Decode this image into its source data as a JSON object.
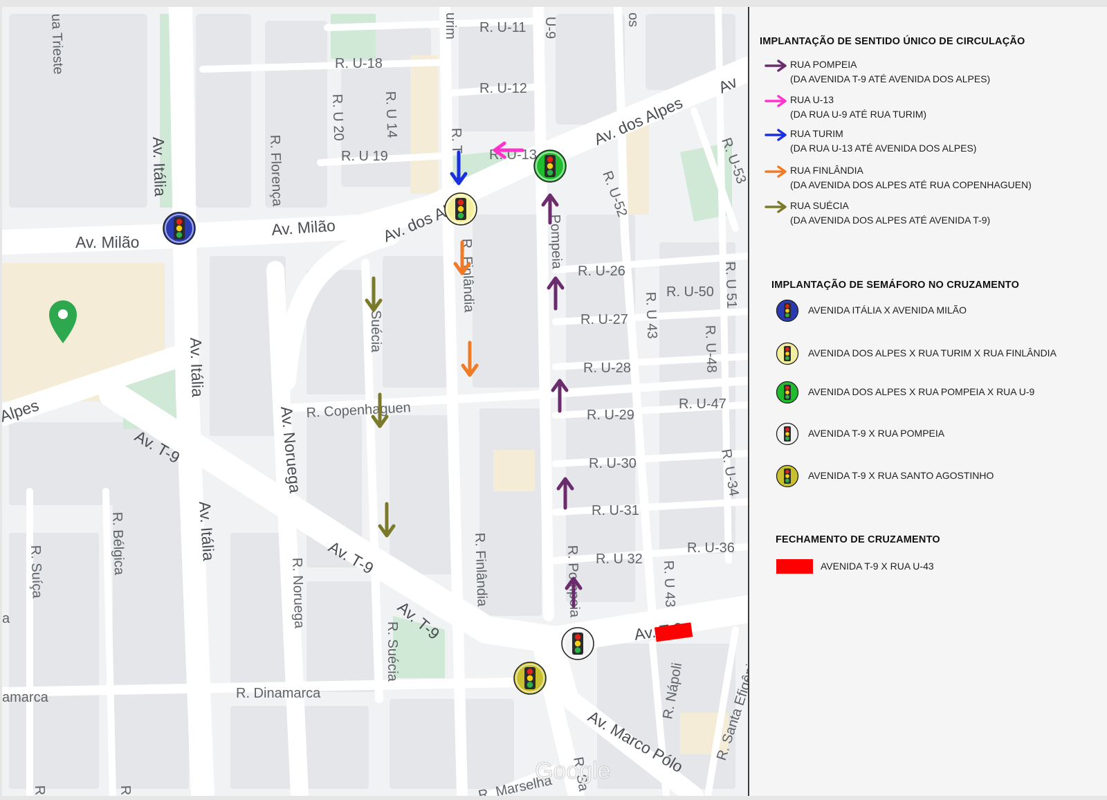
{
  "colors": {
    "pompeia": "#6b2c6e",
    "u13": "#ff33cc",
    "turim": "#1a2fe0",
    "finlandia": "#f07a26",
    "suecia": "#7b7a2a",
    "closure": "#ff0000",
    "ring_italia_milao": "#2a3bb0",
    "ring_alpes_turim": "#f3ef9c",
    "ring_alpes_pompeia": "#1fbd2e",
    "ring_t9_pompeia": "#f2f2f2",
    "ring_t9_agostinho": "#c9c02e",
    "pin": "#2ea84f"
  },
  "map": {
    "labels": {
      "av_italia_1": "Av. Itália",
      "av_italia_2": "Av. Itália",
      "av_italia_3": "Av. Itália",
      "av_milao": "Av. Milão",
      "av_milao_2": "Av. Milão",
      "av_alpes_1": "Av. dos Alpes",
      "av_alpes_2": "Av. dos Alpes",
      "av_alpes_left": "Alpes",
      "av_alpes_right": "Av",
      "av_t9_1": "Av. T-9",
      "av_t9_2": "Av. T-9",
      "av_t9_3": "Av. T-9",
      "av_t9_4": "Av. T-9",
      "av_noruega": "Av. Noruega",
      "av_marco_polo": "Av. Marco Pólo",
      "r_trieste": "ua Trieste",
      "r_u18": "R. U-18",
      "r_u11": "R. U-11",
      "r_u12": "R. U-12",
      "r_u9": "U-9",
      "r_os": "os",
      "r_urim": "urim",
      "r_florenca": "R. Florença",
      "r_u20": "R. U 20",
      "r_u14": "R. U 14",
      "r_u19": "R. U 19",
      "r_turim": "R. T",
      "r_u13": "R. U-13",
      "r_u52": "R. U-52",
      "r_u53": "R. U-53",
      "r_pompeia_1": "Pompeia",
      "r_finlandia_1": "R. Finlândia",
      "r_u26": "R. U-26",
      "r_u27": "R. U-27",
      "r_u28": "R. U-28",
      "r_u29": "R. U-29",
      "r_u30": "R. U-30",
      "r_u31": "R. U-31",
      "r_u32": "R. U 32",
      "r_u43_1": "R. U 43",
      "r_u43_2": "R. U 43",
      "r_u50": "R. U-50",
      "r_u51": "R. U 51",
      "r_u48": "R. U-48",
      "r_u47": "R. U-47",
      "r_u34": "R. U-34",
      "r_u36": "R. U-36",
      "r_suecia_1": "Suécia",
      "r_suecia_2": "R. Suécia",
      "r_copenhaguen": "R. Copenhaguen",
      "r_finlandia_2": "R. Finlândia",
      "r_belgica": "R. Bélgica",
      "r_suica": "R. Suíça",
      "r_noruega": "R. Noruega",
      "r_pompeia_2": "R. Pompeia",
      "r_dinamarca_1": "amarca",
      "r_dinamarca_2": "R. Dinamarca",
      "r_napoli": "R. Nápoli",
      "r_santa_efigenia": "R. Santa Efigênia",
      "r_marselha": "R. Marselha",
      "r_sa": "R. Sa",
      "r_edge_1": "R.",
      "r_edge_2": "R",
      "r_edge_3": "a",
      "google": "Google"
    }
  },
  "legend": {
    "oneway_title": "IMPLANTAÇÃO DE SENTIDO ÚNICO DE CIRCULAÇÃO",
    "oneway": [
      {
        "street": "RUA POMPEIA",
        "range": "(DA AVENIDA T-9 ATÉ AVENIDA DOS ALPES)",
        "color": "#6b2c6e"
      },
      {
        "street": "RUA U-13",
        "range": "(DA RUA U-9 ATÉ RUA TURIM)",
        "color": "#ff33cc"
      },
      {
        "street": "RUA TURIM",
        "range": "(DA RUA U-13 ATÉ AVENIDA DOS ALPES)",
        "color": "#1a2fe0"
      },
      {
        "street": "RUA FINLÂNDIA",
        "range": "(DA AVENIDA DOS ALPES ATÉ RUA COPENHAGUEN)",
        "color": "#f07a26"
      },
      {
        "street": "RUA SUÉCIA",
        "range": "(DA AVENIDA DOS ALPES ATÉ AVENIDA T-9)",
        "color": "#7b7a2a"
      }
    ],
    "signals_title": "IMPLANTAÇÃO DE SEMÁFORO NO CRUZAMENTO",
    "signals": [
      {
        "label": "AVENIDA ITÁLIA X AVENIDA MILÃO",
        "ring": "#2a3bb0"
      },
      {
        "label": "AVENIDA DOS ALPES X RUA TURIM X RUA FINLÂNDIA",
        "ring": "#f3ef9c"
      },
      {
        "label": "AVENIDA DOS ALPES X RUA POMPEIA X RUA U-9",
        "ring": "#1fbd2e"
      },
      {
        "label": "AVENIDA T-9 X RUA POMPEIA",
        "ring": "#f2f2f2"
      },
      {
        "label": "AVENIDA T-9 X RUA SANTO AGOSTINHO",
        "ring": "#c9c02e"
      }
    ],
    "closure_title": "FECHAMENTO DE CRUZAMENTO",
    "closure": {
      "label": "AVENIDA T-9 X RUA U-43",
      "color": "#ff0000"
    }
  }
}
